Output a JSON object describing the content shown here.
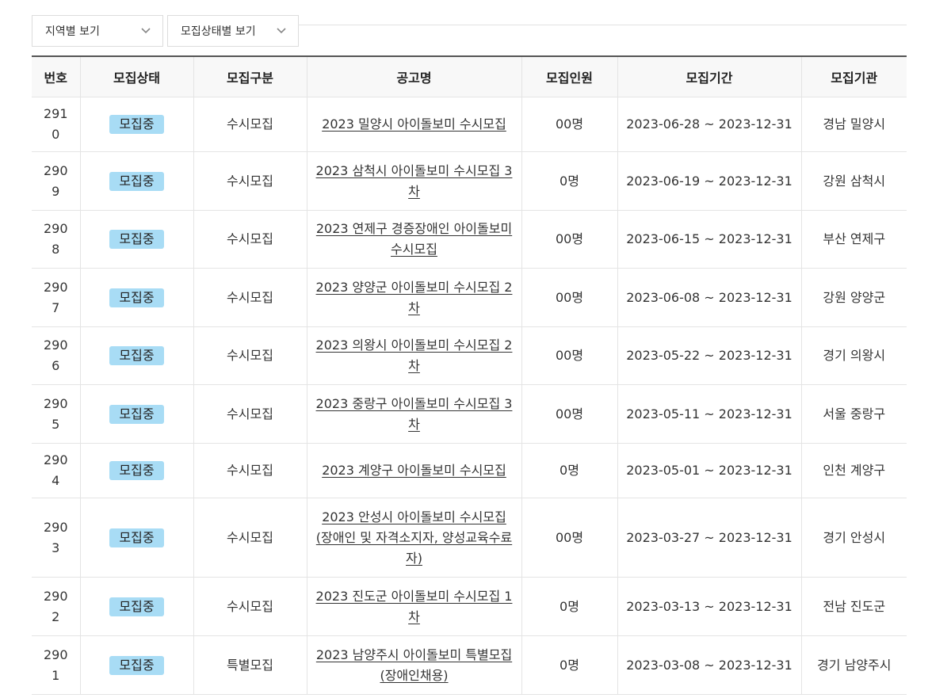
{
  "filters": {
    "region_label": "지역별 보기",
    "status_label": "모집상태별 보기"
  },
  "table": {
    "headers": [
      "번호",
      "모집상태",
      "모집구분",
      "공고명",
      "모집인원",
      "모집기간",
      "모집기관"
    ],
    "rows": [
      {
        "no": "2910",
        "status": "모집중",
        "type": "수시모집",
        "title": "2023 밀양시 아이돌보미 수시모집",
        "count": "00명",
        "period": "2023-06-28 ~ 2023-12-31",
        "agency": "경남 밀양시"
      },
      {
        "no": "2909",
        "status": "모집중",
        "type": "수시모집",
        "title": "2023 삼척시 아이돌보미 수시모집 3차",
        "count": "0명",
        "period": "2023-06-19 ~ 2023-12-31",
        "agency": "강원 삼척시"
      },
      {
        "no": "2908",
        "status": "모집중",
        "type": "수시모집",
        "title": "2023 연제구 경증장애인 아이돌보미 수시모집",
        "count": "00명",
        "period": "2023-06-15 ~ 2023-12-31",
        "agency": "부산 연제구"
      },
      {
        "no": "2907",
        "status": "모집중",
        "type": "수시모집",
        "title": "2023 양양군 아이돌보미 수시모집 2차",
        "count": "00명",
        "period": "2023-06-08 ~ 2023-12-31",
        "agency": "강원 양양군"
      },
      {
        "no": "2906",
        "status": "모집중",
        "type": "수시모집",
        "title": "2023 의왕시 아이돌보미 수시모집 2차",
        "count": "00명",
        "period": "2023-05-22 ~ 2023-12-31",
        "agency": "경기 의왕시"
      },
      {
        "no": "2905",
        "status": "모집중",
        "type": "수시모집",
        "title": "2023 중랑구 아이돌보미 수시모집 3차",
        "count": "00명",
        "period": "2023-05-11 ~ 2023-12-31",
        "agency": "서울 중랑구"
      },
      {
        "no": "2904",
        "status": "모집중",
        "type": "수시모집",
        "title": "2023 계양구 아이돌보미 수시모집",
        "count": "0명",
        "period": "2023-05-01 ~ 2023-12-31",
        "agency": "인천 계양구"
      },
      {
        "no": "2903",
        "status": "모집중",
        "type": "수시모집",
        "title": "2023 안성시 아이돌보미 수시모집 (장애인 및 자격소지자, 양성교육수료자)",
        "count": "00명",
        "period": "2023-03-27 ~ 2023-12-31",
        "agency": "경기 안성시"
      },
      {
        "no": "2902",
        "status": "모집중",
        "type": "수시모집",
        "title": "2023 진도군 아이돌보미 수시모집 1차",
        "count": "0명",
        "period": "2023-03-13 ~ 2023-12-31",
        "agency": "전남 진도군"
      },
      {
        "no": "2901",
        "status": "모집중",
        "type": "특별모집",
        "title": "2023 남양주시 아이돌보미 특별모집(장애인채용)",
        "count": "0명",
        "period": "2023-03-08 ~ 2023-12-31",
        "agency": "경기 남양주시"
      }
    ]
  },
  "colors": {
    "badge_bg": "#a8dcf5",
    "header_bg": "#f8f8f8"
  }
}
